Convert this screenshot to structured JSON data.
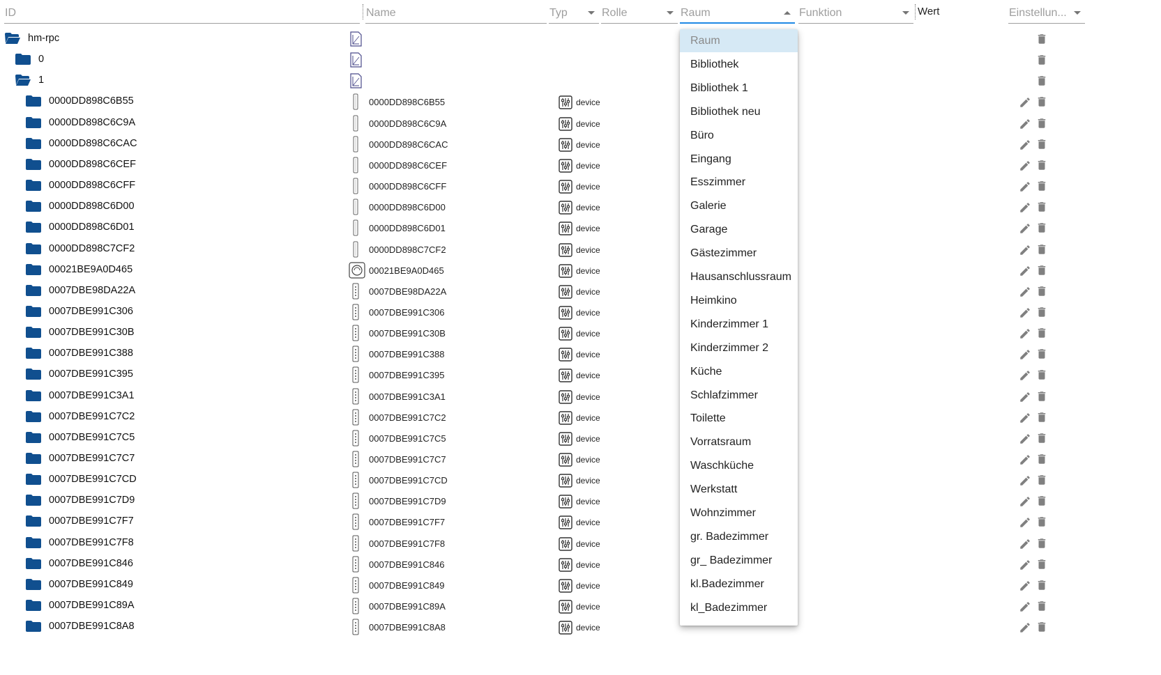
{
  "header": {
    "id_label": "ID",
    "name_label": "Name",
    "typ_label": "Typ",
    "rolle_label": "Rolle",
    "raum_label": "Raum",
    "funktion_label": "Funktion",
    "wert_label": "Wert",
    "einstellungen_label": "Einstellun..."
  },
  "colors": {
    "folder": "#104f8f",
    "accent": "#1e88e5",
    "icon_gray": "#808080"
  },
  "rows": [
    {
      "id": "hm-rpc",
      "name": "",
      "type": "",
      "folder": "open"
    },
    {
      "id": "0",
      "name": "",
      "type": "",
      "folder": "closed"
    },
    {
      "id": "1",
      "name": "",
      "type": "",
      "folder": "open"
    },
    {
      "id": "0000DD898C6B55",
      "name": "0000DD898C6B55",
      "type": "device"
    },
    {
      "id": "0000DD898C6C9A",
      "name": "0000DD898C6C9A",
      "type": "device"
    },
    {
      "id": "0000DD898C6CAC",
      "name": "0000DD898C6CAC",
      "type": "device"
    },
    {
      "id": "0000DD898C6CEF",
      "name": "0000DD898C6CEF",
      "type": "device"
    },
    {
      "id": "0000DD898C6CFF",
      "name": "0000DD898C6CFF",
      "type": "device"
    },
    {
      "id": "0000DD898C6D00",
      "name": "0000DD898C6D00",
      "type": "device"
    },
    {
      "id": "0000DD898C6D01",
      "name": "0000DD898C6D01",
      "type": "device"
    },
    {
      "id": "0000DD898C7CF2",
      "name": "0000DD898C7CF2",
      "type": "device"
    },
    {
      "id": "00021BE9A0D465",
      "name": "00021BE9A0D465",
      "type": "device"
    },
    {
      "id": "0007DBE98DA22A",
      "name": "0007DBE98DA22A",
      "type": "device"
    },
    {
      "id": "0007DBE991C306",
      "name": "0007DBE991C306",
      "type": "device"
    },
    {
      "id": "0007DBE991C30B",
      "name": "0007DBE991C30B",
      "type": "device"
    },
    {
      "id": "0007DBE991C388",
      "name": "0007DBE991C388",
      "type": "device"
    },
    {
      "id": "0007DBE991C395",
      "name": "0007DBE991C395",
      "type": "device"
    },
    {
      "id": "0007DBE991C3A1",
      "name": "0007DBE991C3A1",
      "type": "device"
    },
    {
      "id": "0007DBE991C7C2",
      "name": "0007DBE991C7C2",
      "type": "device"
    },
    {
      "id": "0007DBE991C7C5",
      "name": "0007DBE991C7C5",
      "type": "device"
    },
    {
      "id": "0007DBE991C7C7",
      "name": "0007DBE991C7C7",
      "type": "device"
    },
    {
      "id": "0007DBE991C7CD",
      "name": "0007DBE991C7CD",
      "type": "device"
    },
    {
      "id": "0007DBE991C7D9",
      "name": "0007DBE991C7D9",
      "type": "device"
    },
    {
      "id": "0007DBE991C7F7",
      "name": "0007DBE991C7F7",
      "type": "device"
    },
    {
      "id": "0007DBE991C7F8",
      "name": "0007DBE991C7F8",
      "type": "device"
    },
    {
      "id": "0007DBE991C846",
      "name": "0007DBE991C846",
      "type": "device"
    },
    {
      "id": "0007DBE991C849",
      "name": "0007DBE991C849",
      "type": "device"
    },
    {
      "id": "0007DBE991C89A",
      "name": "0007DBE991C89A",
      "type": "device"
    },
    {
      "id": "0007DBE991C8A8",
      "name": "0007DBE991C8A8",
      "type": "device"
    }
  ],
  "raum_dropdown": {
    "selected": "Raum",
    "options": [
      "Raum",
      "Bibliothek",
      "Bibliothek 1",
      "Bibliothek neu",
      "Büro",
      "Eingang",
      "Esszimmer",
      "Galerie",
      "Garage",
      "Gästezimmer",
      "Hausanschlussraum",
      "Heimkino",
      "Kinderzimmer 1",
      "Kinderzimmer 2",
      "Küche",
      "Schlafzimmer",
      "Toilette",
      "Vorratsraum",
      "Waschküche",
      "Werkstatt",
      "Wohnzimmer",
      "gr. Badezimmer",
      "gr_ Badezimmer",
      "kl.Badezimmer",
      "kl_Badezimmer"
    ]
  }
}
